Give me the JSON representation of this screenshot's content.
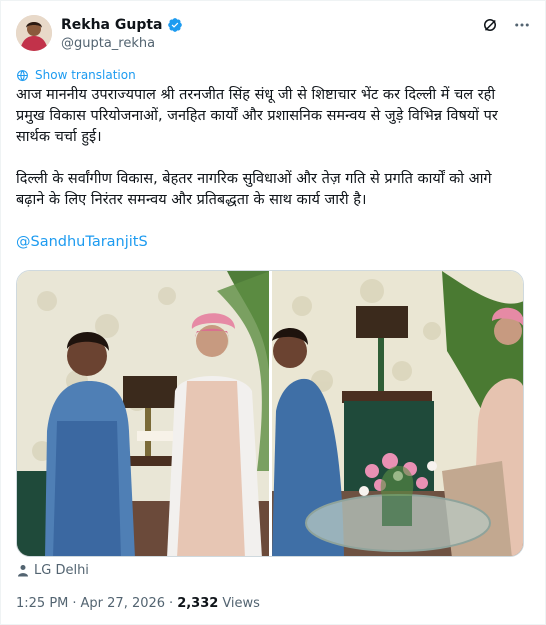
{
  "author": {
    "display_name": "Rekha Gupta",
    "handle": "@gupta_rekha"
  },
  "icons": {
    "verified": "verified-badge-icon",
    "grok": "grok-icon",
    "more": "more-options-icon",
    "translate": "globe-icon",
    "location": "person-location-icon"
  },
  "colors": {
    "accent": "#1d9bf0",
    "text": "#0f1419",
    "secondary": "#536471"
  },
  "post": {
    "translate_label": "Show translation",
    "paragraph_1": "आज माननीय उपराज्यपाल श्री तरनजीत सिंह संधू जी से शिष्टाचार भेंट कर दिल्ली में चल रही प्रमुख विकास परियोजनाओं, जनहित कार्यों और प्रशासनिक समन्वय से जुड़े विभिन्न विषयों पर सार्थक चर्चा हुई।",
    "paragraph_2": "दिल्ली के सर्वांगीण विकास, बेहतर नागरिक सुविधाओं और तेज़ गति से प्रगति कार्यों को आगे बढ़ाने के लिए निरंतर समन्वय और प्रतिबद्धता के साथ कार्य जारी है।",
    "mention": "@SandhuTaranjitS"
  },
  "location": {
    "label": "LG Delhi"
  },
  "meta": {
    "time": "1:25 PM",
    "separator": "·",
    "date": "Apr 27, 2026",
    "views_count": "2,332",
    "views_label": "Views"
  }
}
